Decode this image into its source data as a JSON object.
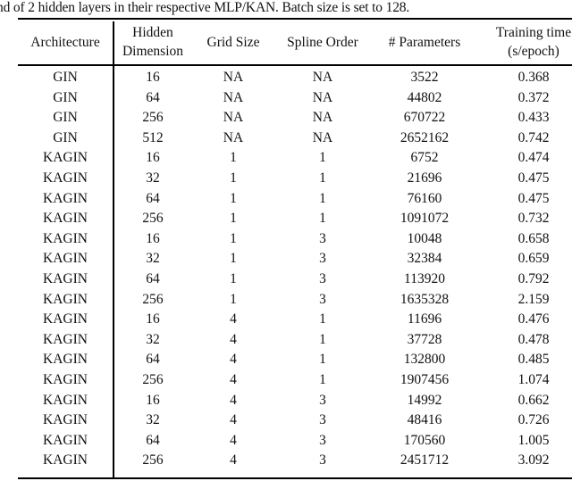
{
  "caption": "nd of 2 hidden layers in their respective MLP/KAN. Batch size is set to 128.",
  "table": {
    "headers": [
      {
        "line1": "Architecture",
        "line2": ""
      },
      {
        "line1": "Hidden",
        "line2": "Dimension"
      },
      {
        "line1": "Grid Size",
        "line2": ""
      },
      {
        "line1": "Spline Order",
        "line2": ""
      },
      {
        "line1": "# Parameters",
        "line2": ""
      },
      {
        "line1": "Training time",
        "line2": "(s/epoch)"
      }
    ],
    "rows": [
      [
        "GIN",
        "16",
        "NA",
        "NA",
        "3522",
        "0.368"
      ],
      [
        "GIN",
        "64",
        "NA",
        "NA",
        "44802",
        "0.372"
      ],
      [
        "GIN",
        "256",
        "NA",
        "NA",
        "670722",
        "0.433"
      ],
      [
        "GIN",
        "512",
        "NA",
        "NA",
        "2652162",
        "0.742"
      ],
      [
        "KAGIN",
        "16",
        "1",
        "1",
        "6752",
        "0.474"
      ],
      [
        "KAGIN",
        "32",
        "1",
        "1",
        "21696",
        "0.475"
      ],
      [
        "KAGIN",
        "64",
        "1",
        "1",
        "76160",
        "0.475"
      ],
      [
        "KAGIN",
        "256",
        "1",
        "1",
        "1091072",
        "0.732"
      ],
      [
        "KAGIN",
        "16",
        "1",
        "3",
        "10048",
        "0.658"
      ],
      [
        "KAGIN",
        "32",
        "1",
        "3",
        "32384",
        "0.659"
      ],
      [
        "KAGIN",
        "64",
        "1",
        "3",
        "113920",
        "0.792"
      ],
      [
        "KAGIN",
        "256",
        "1",
        "3",
        "1635328",
        "2.159"
      ],
      [
        "KAGIN",
        "16",
        "4",
        "1",
        "11696",
        "0.476"
      ],
      [
        "KAGIN",
        "32",
        "4",
        "1",
        "37728",
        "0.478"
      ],
      [
        "KAGIN",
        "64",
        "4",
        "1",
        "132800",
        "0.485"
      ],
      [
        "KAGIN",
        "256",
        "4",
        "1",
        "1907456",
        "1.074"
      ],
      [
        "KAGIN",
        "16",
        "4",
        "3",
        "14992",
        "0.662"
      ],
      [
        "KAGIN",
        "32",
        "4",
        "3",
        "48416",
        "0.726"
      ],
      [
        "KAGIN",
        "64",
        "4",
        "3",
        "170560",
        "1.005"
      ],
      [
        "KAGIN",
        "256",
        "4",
        "3",
        "2451712",
        "3.092"
      ]
    ]
  }
}
